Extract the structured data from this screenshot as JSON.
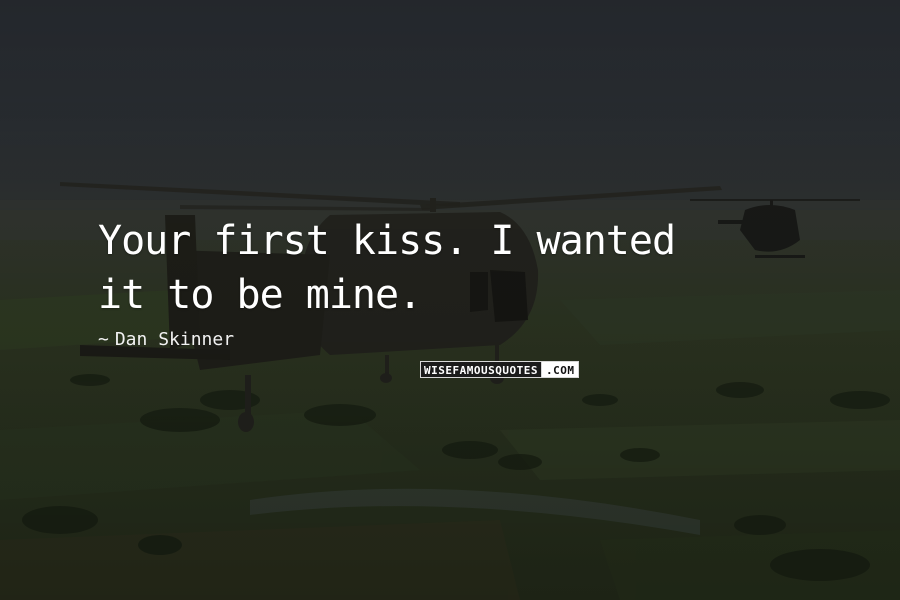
{
  "quote": {
    "line1": "Your first kiss. I wanted",
    "line2": "it to be mine.",
    "author_dash": "~",
    "author": "Dan Skinner"
  },
  "watermark": {
    "main": "WISEFAMOUSQUOTES",
    "suffix": ".COM",
    "logo_bg": "#1b1b1b",
    "suffix_bg": "#ffffff"
  },
  "scene": {
    "sky_color": "#2b2f35",
    "field_color": "#2f3b24",
    "helicopter_color": "#2a2a24"
  },
  "text_color": "#ffffff"
}
